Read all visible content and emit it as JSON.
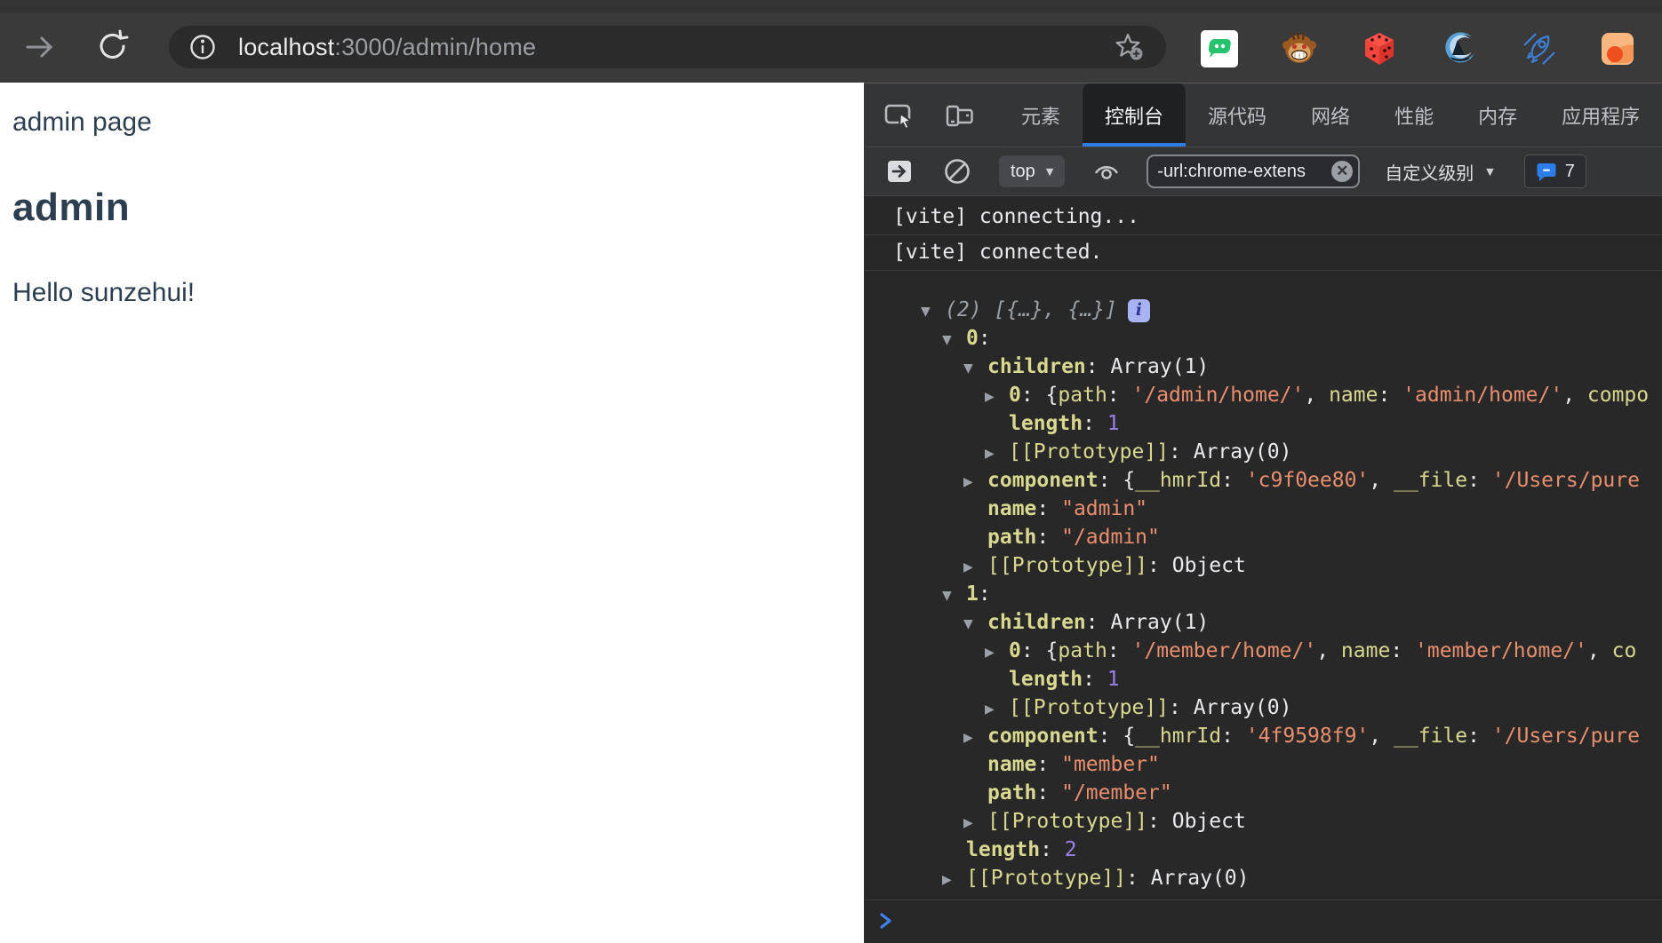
{
  "browser": {
    "url_host": "localhost",
    "url_rest": ":3000/admin/home",
    "icons": [
      "forward-arrow-icon",
      "reload-icon",
      "info-icon",
      "bookmark-star-icon"
    ],
    "extensions": [
      "green-chat-extension",
      "monkey-extension",
      "red-dice-extension",
      "wave-sailboat-extension",
      "rocket-extension",
      "orange-blob-extension"
    ]
  },
  "page": {
    "subtitle": "admin page",
    "title": "admin",
    "greeting": "Hello sunzehui!",
    "text_color": "#2c3e50"
  },
  "devtools": {
    "tabs": [
      {
        "label": "元素",
        "active": false
      },
      {
        "label": "控制台",
        "active": true
      },
      {
        "label": "源代码",
        "active": false
      },
      {
        "label": "网络",
        "active": false
      },
      {
        "label": "性能",
        "active": false
      },
      {
        "label": "内存",
        "active": false
      },
      {
        "label": "应用程序",
        "active": false
      }
    ],
    "toolbar": {
      "icons": [
        "show-console-sidebar-icon",
        "clear-console-icon",
        "live-expression-eye-icon"
      ],
      "context_selector": "top",
      "filter_value": "-url:chrome-extens",
      "level_selector": "自定义级别",
      "issues_count": "7"
    },
    "console": {
      "messages": [
        "[vite] connecting...",
        "[vite] connected."
      ],
      "tree": [
        {
          "level": 0,
          "arrow": "open",
          "badge": true,
          "segments": [
            [
              "(2) [{…}, {…}]",
              "it"
            ]
          ]
        },
        {
          "level": 1,
          "arrow": "open",
          "segments": [
            [
              "0",
              "k"
            ],
            [
              ": ",
              "p"
            ]
          ]
        },
        {
          "level": 2,
          "arrow": "open",
          "segments": [
            [
              "children",
              "k"
            ],
            [
              ": ",
              "p"
            ],
            [
              "Array(1)",
              "p"
            ]
          ]
        },
        {
          "level": 3,
          "arrow": "closed",
          "segments": [
            [
              "0",
              "k"
            ],
            [
              ": {",
              "p"
            ],
            [
              "path",
              "kp"
            ],
            [
              ": ",
              "p"
            ],
            [
              "'/admin/home/'",
              "s"
            ],
            [
              ", ",
              "p"
            ],
            [
              "name",
              "kp"
            ],
            [
              ": ",
              "p"
            ],
            [
              "'admin/home/'",
              "s"
            ],
            [
              ", ",
              "p"
            ],
            [
              "compo",
              "kp"
            ]
          ]
        },
        {
          "level": 3,
          "arrow": "none",
          "segments": [
            [
              "length",
              "k"
            ],
            [
              ": ",
              "p"
            ],
            [
              "1",
              "n"
            ]
          ]
        },
        {
          "level": 3,
          "arrow": "closed",
          "segments": [
            [
              "[[Prototype]]",
              "kp"
            ],
            [
              ": ",
              "p"
            ],
            [
              "Array(0)",
              "p"
            ]
          ]
        },
        {
          "level": 2,
          "arrow": "closed",
          "segments": [
            [
              "component",
              "k"
            ],
            [
              ": {",
              "p"
            ],
            [
              "__hmrId",
              "kp"
            ],
            [
              ": ",
              "p"
            ],
            [
              "'c9f0ee80'",
              "s"
            ],
            [
              ", ",
              "p"
            ],
            [
              "__file",
              "kp"
            ],
            [
              ": ",
              "p"
            ],
            [
              "'/Users/pure",
              "s"
            ]
          ]
        },
        {
          "level": 2,
          "arrow": "none",
          "segments": [
            [
              "name",
              "k"
            ],
            [
              ": ",
              "p"
            ],
            [
              "\"admin\"",
              "s"
            ]
          ]
        },
        {
          "level": 2,
          "arrow": "none",
          "segments": [
            [
              "path",
              "k"
            ],
            [
              ": ",
              "p"
            ],
            [
              "\"/admin\"",
              "s"
            ]
          ]
        },
        {
          "level": 2,
          "arrow": "closed",
          "segments": [
            [
              "[[Prototype]]",
              "kp"
            ],
            [
              ": ",
              "p"
            ],
            [
              "Object",
              "p"
            ]
          ]
        },
        {
          "level": 1,
          "arrow": "open",
          "segments": [
            [
              "1",
              "k"
            ],
            [
              ": ",
              "p"
            ]
          ]
        },
        {
          "level": 2,
          "arrow": "open",
          "segments": [
            [
              "children",
              "k"
            ],
            [
              ": ",
              "p"
            ],
            [
              "Array(1)",
              "p"
            ]
          ]
        },
        {
          "level": 3,
          "arrow": "closed",
          "segments": [
            [
              "0",
              "k"
            ],
            [
              ": {",
              "p"
            ],
            [
              "path",
              "kp"
            ],
            [
              ": ",
              "p"
            ],
            [
              "'/member/home/'",
              "s"
            ],
            [
              ", ",
              "p"
            ],
            [
              "name",
              "kp"
            ],
            [
              ": ",
              "p"
            ],
            [
              "'member/home/'",
              "s"
            ],
            [
              ", ",
              "p"
            ],
            [
              "co",
              "kp"
            ]
          ]
        },
        {
          "level": 3,
          "arrow": "none",
          "segments": [
            [
              "length",
              "k"
            ],
            [
              ": ",
              "p"
            ],
            [
              "1",
              "n"
            ]
          ]
        },
        {
          "level": 3,
          "arrow": "closed",
          "segments": [
            [
              "[[Prototype]]",
              "kp"
            ],
            [
              ": ",
              "p"
            ],
            [
              "Array(0)",
              "p"
            ]
          ]
        },
        {
          "level": 2,
          "arrow": "closed",
          "segments": [
            [
              "component",
              "k"
            ],
            [
              ": {",
              "p"
            ],
            [
              "__hmrId",
              "kp"
            ],
            [
              ": ",
              "p"
            ],
            [
              "'4f9598f9'",
              "s"
            ],
            [
              ", ",
              "p"
            ],
            [
              "__file",
              "kp"
            ],
            [
              ": ",
              "p"
            ],
            [
              "'/Users/pure",
              "s"
            ]
          ]
        },
        {
          "level": 2,
          "arrow": "none",
          "segments": [
            [
              "name",
              "k"
            ],
            [
              ": ",
              "p"
            ],
            [
              "\"member\"",
              "s"
            ]
          ]
        },
        {
          "level": 2,
          "arrow": "none",
          "segments": [
            [
              "path",
              "k"
            ],
            [
              ": ",
              "p"
            ],
            [
              "\"/member\"",
              "s"
            ]
          ]
        },
        {
          "level": 2,
          "arrow": "closed",
          "segments": [
            [
              "[[Prototype]]",
              "kp"
            ],
            [
              ": ",
              "p"
            ],
            [
              "Object",
              "p"
            ]
          ]
        },
        {
          "level": 1,
          "arrow": "none",
          "segments": [
            [
              "length",
              "k"
            ],
            [
              ": ",
              "p"
            ],
            [
              "2",
              "n"
            ]
          ]
        },
        {
          "level": 1,
          "arrow": "closed",
          "segments": [
            [
              "[[Prototype]]",
              "kp"
            ],
            [
              ": ",
              "p"
            ],
            [
              "Array(0)",
              "p"
            ]
          ]
        }
      ]
    },
    "colors": {
      "toolbar_bg": "#343536",
      "console_bg": "#282828",
      "active_tab_underline": "#2d7ce8",
      "key": "#d8d890",
      "string": "#e98e6e",
      "number": "#9b80ea",
      "muted": "#9aa0a6",
      "prompt_chevron": "#3f80f3",
      "info_badge_bg": "#a9b2f2"
    }
  }
}
